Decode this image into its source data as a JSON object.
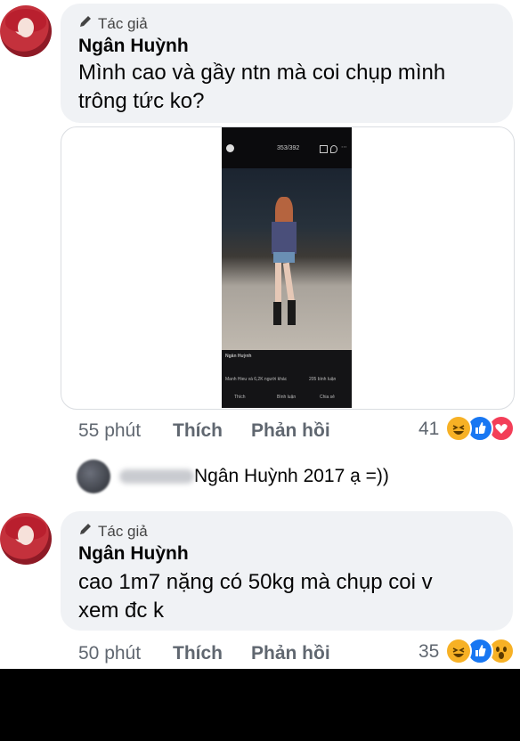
{
  "comments": [
    {
      "author_tag": "Tác giả",
      "author_name": "Ngân Huỳnh",
      "text": "Mình cao và gầy ntn mà coi chụp mình\ntrông tức ko?",
      "time": "55 phút",
      "like_label": "Thích",
      "reply_label": "Phản hồi",
      "reaction_count": "41",
      "reactions": [
        "haha",
        "like",
        "love"
      ]
    },
    {
      "author_tag": "Tác giả",
      "author_name": "Ngân Huỳnh",
      "text": "cao 1m7 nặng có 50kg mà chụp coi v\nxem đc k",
      "time": "50 phút",
      "like_label": "Thích",
      "reply_label": "Phản hồi",
      "reaction_count": "35",
      "reactions": [
        "haha",
        "like",
        "wow"
      ]
    }
  ],
  "reply_preview": {
    "text": "Ngân Huỳnh 2017 ạ =))"
  },
  "attached_photo": {
    "counter": "353/392",
    "poster_name": "Ngân Huỳnh",
    "reactions_text": "Manh Hieu và 6,2K người khác",
    "comments_text": "205 bình luận",
    "actions": [
      "Thích",
      "Bình luận",
      "Chia sẻ"
    ]
  },
  "colors": {
    "bubble": "#f0f2f5",
    "meta_text": "#606770",
    "like_blue": "#1877f2",
    "love_red": "#f33e58",
    "haha_yellow": "#f7b125"
  }
}
